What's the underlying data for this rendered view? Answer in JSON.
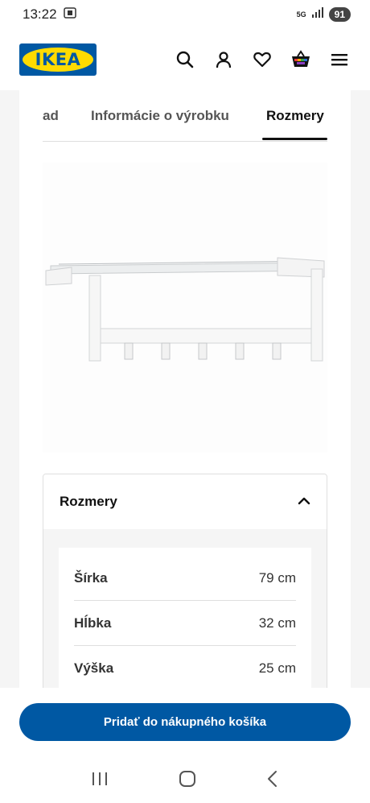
{
  "status_bar": {
    "time": "13:22",
    "network": "5G",
    "battery": "91",
    "icons": [
      "screenshot-icon",
      "signal-icon",
      "battery-icon"
    ]
  },
  "header": {
    "logo_text": "IKEA",
    "icons": [
      "search-icon",
      "account-icon",
      "heart-icon",
      "cart-icon",
      "menu-icon"
    ]
  },
  "tabs": [
    {
      "label": "ad"
    },
    {
      "label": "Informácie o výrobku"
    },
    {
      "label": "Rozmery",
      "active": true
    }
  ],
  "dimensions": {
    "title": "Rozmery",
    "expanded": true,
    "rows": [
      {
        "label": "Šírka",
        "value": "79 cm"
      },
      {
        "label": "Hĺbka",
        "value": "32 cm"
      },
      {
        "label": "Výška",
        "value": "25 cm"
      }
    ]
  },
  "cart_button": {
    "label": "Pridať do nákupného košíka"
  },
  "colors": {
    "brand_blue": "#0058a3",
    "brand_yellow": "#ffdb00",
    "background_gray": "#f5f5f5"
  },
  "nav_bar": {
    "icons": [
      "recent-apps-icon",
      "home-icon",
      "back-icon"
    ]
  }
}
